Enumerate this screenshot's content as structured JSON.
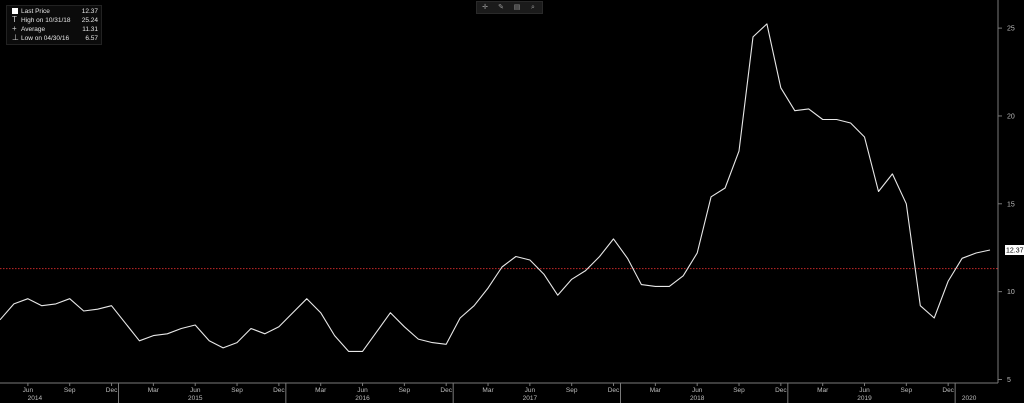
{
  "legend": {
    "items": [
      {
        "glyph": "box",
        "label": "Last Price",
        "value": "12.37"
      },
      {
        "glyph": "T",
        "label": "High on 10/31/18",
        "value": "25.24"
      },
      {
        "glyph": "+",
        "label": "Average",
        "value": "11.31"
      },
      {
        "glyph": "⊥",
        "label": "Low on 04/30/16",
        "value": "6.57"
      }
    ]
  },
  "toolbar": {
    "buttons": [
      {
        "name": "crosshair-icon",
        "glyph": "✛"
      },
      {
        "name": "pencil-icon",
        "glyph": "✎"
      },
      {
        "name": "layers-icon",
        "glyph": "▤"
      },
      {
        "name": "zoom-icon",
        "glyph": "⌕"
      }
    ]
  },
  "chart_data": {
    "type": "line",
    "series": [
      {
        "values": [
          8.4,
          9.3,
          9.6,
          9.2,
          9.3,
          9.6,
          8.9,
          9.0,
          9.2,
          8.2,
          7.2,
          7.5,
          7.6,
          7.9,
          8.1,
          7.2,
          6.8,
          7.1,
          7.9,
          7.6,
          8.0,
          8.8,
          9.6,
          8.8,
          7.5,
          6.6,
          6.6,
          7.7,
          8.8,
          8.0,
          7.3,
          7.1,
          7.0,
          8.5,
          9.2,
          10.2,
          11.4,
          12.0,
          11.8,
          11.0,
          9.8,
          10.7,
          11.2,
          12.0,
          13.0,
          11.9,
          10.4,
          10.3,
          10.3,
          10.9,
          12.2,
          15.4,
          15.9,
          18.0,
          24.5,
          25.24,
          21.6,
          20.3,
          20.4,
          19.8,
          19.8,
          19.6,
          18.8,
          15.7,
          16.7,
          15.0,
          9.2,
          8.5,
          10.6,
          11.9,
          12.2,
          12.37
        ]
      }
    ],
    "start": "2014-04-30",
    "interval": "monthly",
    "average": 11.31,
    "last_value": "12.37",
    "x_axis": {
      "month_labels": [
        "Jun",
        "Sep",
        "Dec",
        "Mar",
        "Jun",
        "Sep",
        "Dec",
        "Mar",
        "Jun",
        "Sep",
        "Dec",
        "Mar",
        "Jun",
        "Sep",
        "Dec",
        "Mar",
        "Jun",
        "Sep",
        "Dec",
        "Mar",
        "Jun",
        "Sep",
        "Dec"
      ],
      "month_index": [
        2,
        5,
        8,
        11,
        14,
        17,
        20,
        23,
        26,
        29,
        32,
        35,
        38,
        41,
        44,
        47,
        50,
        53,
        56,
        59,
        62,
        65,
        68
      ],
      "year_labels": [
        "2014",
        "2015",
        "2016",
        "2017",
        "2018",
        "2019",
        "2020"
      ],
      "year_index": [
        2.5,
        14,
        26,
        38,
        50,
        62,
        69.5
      ],
      "year_boundaries": [
        8.5,
        20.5,
        32.5,
        44.5,
        56.5,
        68.5
      ]
    },
    "y_axis": {
      "ticks": [
        5,
        10,
        15,
        20,
        25
      ],
      "ylim": [
        4.8,
        26.6
      ]
    },
    "grid": false,
    "legend_position": "top-left",
    "colors": {
      "line": "#e8e8e8",
      "average_line": "#c42a2a",
      "background": "#000000",
      "axis": "#7a7a7a",
      "tick_text": "#bdbdbd",
      "last_value_box": "#ffffff",
      "last_value_text": "#000000"
    }
  }
}
